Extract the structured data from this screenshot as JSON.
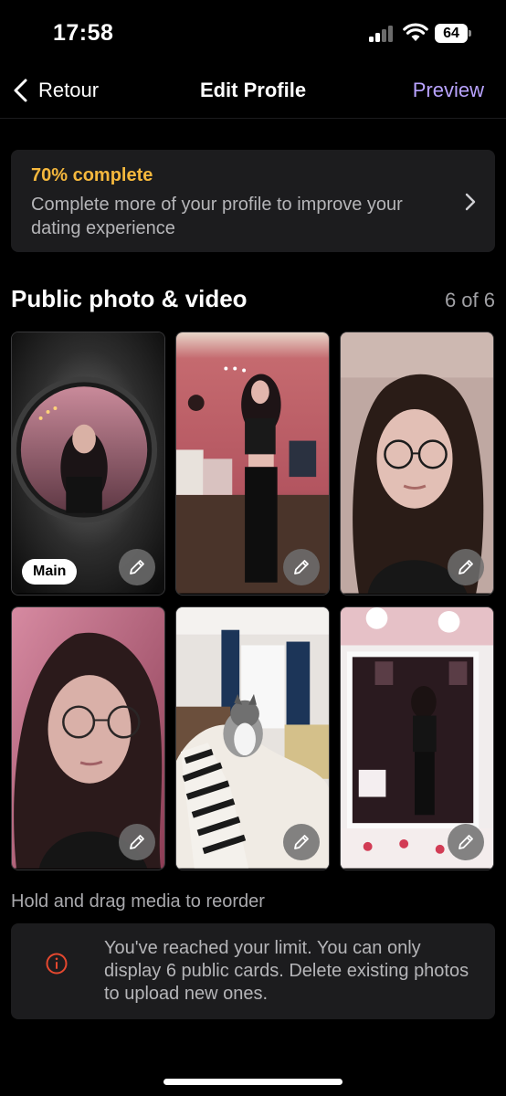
{
  "status_bar": {
    "time": "17:58",
    "battery": "64"
  },
  "nav": {
    "back_label": "Retour",
    "title": "Edit Profile",
    "preview_label": "Preview"
  },
  "completion": {
    "percent_label": "70% complete",
    "description": "Complete more of your profile to improve your dating experience"
  },
  "media_section": {
    "title": "Public photo & video",
    "count": "6 of 6",
    "main_badge": "Main",
    "items": [
      {
        "kind": "selfie in round mirror"
      },
      {
        "kind": "full-body mirror selfie"
      },
      {
        "kind": "close-up selfie with glasses"
      },
      {
        "kind": "selfie with glasses pink light"
      },
      {
        "kind": "cat on striped sweater"
      },
      {
        "kind": "mirror selfie with stickers"
      }
    ]
  },
  "hint": "Hold and drag media to reorder",
  "limit_notice": "You've reached your limit. You can only display 6 public cards. Delete existing photos to upload new ones.",
  "colors": {
    "accent": "#b9a3ff",
    "completion": "#f5b83d",
    "warning": "#e5482f",
    "card_bg": "#1c1c1e"
  }
}
